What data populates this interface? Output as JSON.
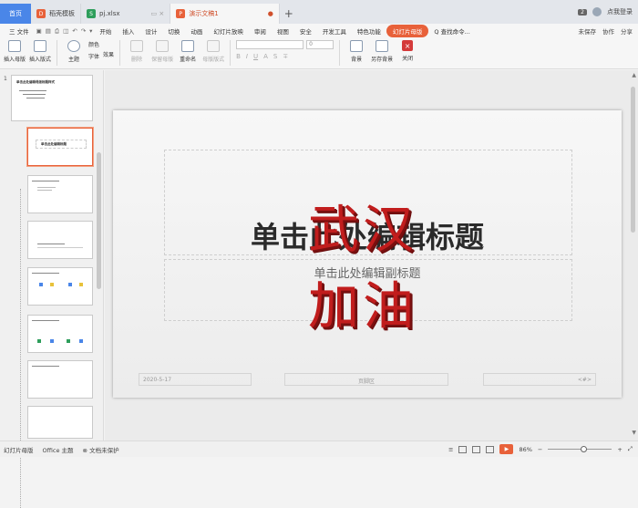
{
  "tabs": {
    "home": "首页",
    "docs": [
      {
        "label": "稻壳模板",
        "color": "#e8613a",
        "glyph": "D"
      },
      {
        "label": "pj.xlsx",
        "color": "#2e9e5b",
        "glyph": "S"
      },
      {
        "label": "演示文稿1",
        "color": "#e8613a",
        "glyph": "P"
      }
    ],
    "right_badge": "2",
    "login": "点我登录"
  },
  "menubar": {
    "file": "三 文件",
    "items": [
      "开始",
      "插入",
      "设计",
      "切换",
      "动画",
      "幻灯片放映",
      "审阅",
      "视图",
      "安全",
      "开发工具",
      "特色功能"
    ],
    "highlight": "幻灯片母版",
    "search": "Q 查找命令...",
    "right": [
      "未保存",
      "协作",
      "分享"
    ]
  },
  "ribbon": {
    "insert_master": "插入母版",
    "insert_layout": "插入版式",
    "theme": "主题",
    "color": "颜色",
    "font": "字体",
    "effect": "效果",
    "delete": "删除",
    "keep_master": "保留母版",
    "rename": "重命名",
    "master_layout": "母版版式",
    "size_value": "0",
    "background": "背景",
    "save_background": "另存背景",
    "close": "关闭"
  },
  "left": {
    "master_number": "1",
    "master_title": "单击此处编辑母版标题样式",
    "thumb_title_small": "单击此处编辑标题"
  },
  "slide": {
    "title": "单击此处编辑标题",
    "subtitle": "单击此处编辑副标题",
    "art_line1": "武汉",
    "art_line2": "加油",
    "date": "2020-5-17",
    "footer": "页脚区",
    "number": "<#>"
  },
  "status": {
    "mode": "幻灯片母版",
    "theme": "Office 主题",
    "protect": "文档未保护",
    "zoom": "86%"
  }
}
